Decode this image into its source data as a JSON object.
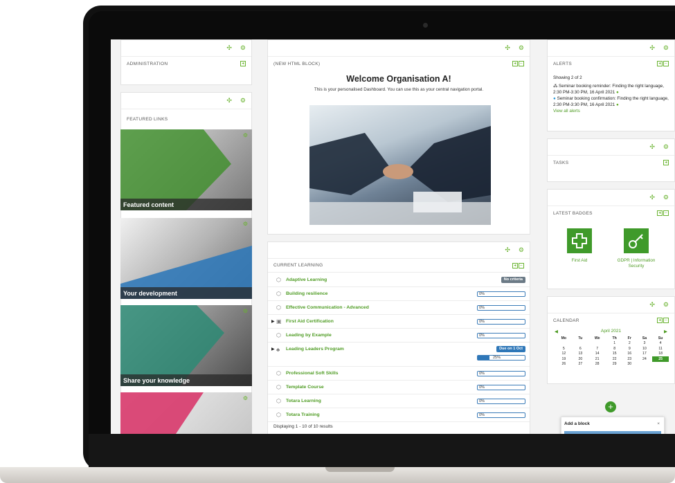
{
  "left": {
    "administration_title": "ADMINISTRATION",
    "featured_title": "FEATURED LINKS",
    "tiles": [
      {
        "label": "Featured content",
        "color": "#3f8f2c"
      },
      {
        "label": "Your development",
        "color": "#2e77b8"
      },
      {
        "label": "Share your knowledge",
        "color": "#2a8a74"
      },
      {
        "label": "",
        "color": "#d8396b"
      }
    ]
  },
  "middle": {
    "html_block_title": "(NEW HTML BLOCK)",
    "welcome_title": "Welcome Organisation A!",
    "welcome_text": "This is your personalised Dashboard.  You can use this as your central navigation portal.",
    "current_learning_title": "CURRENT LEARNING",
    "items": [
      {
        "name": "Adaptive Learning",
        "status": "No criteria"
      },
      {
        "name": "Building resilience",
        "progress": "0%"
      },
      {
        "name": "Effective Communication - Advanced",
        "progress": "0%"
      },
      {
        "name": "First Aid Certification",
        "progress": "0%"
      },
      {
        "name": "Leading by Example",
        "progress": "0%"
      },
      {
        "name": "Leading Leaders Program",
        "due": "Due on 1 Oct",
        "progress": "25%",
        "progress_value": 0.25
      },
      {
        "name": "Professional Soft Skills",
        "progress": "0%"
      },
      {
        "name": "Template Course",
        "progress": "0%"
      },
      {
        "name": "Totara Learning",
        "progress": "0%"
      },
      {
        "name": "Totara Training",
        "progress": "0%"
      }
    ],
    "footer": "Displaying 1 - 10 of 10 results"
  },
  "right": {
    "alerts_title": "ALERTS",
    "alerts_showing": "Showing 2 of 2",
    "alert_1": "Seminar booking reminder: Finding the right language, 2:30 PM-3:30 PM, 16 April 2021",
    "alert_2": "Seminar booking confirmation: Finding the right language, 2:30 PM-3:30 PM, 16 April 2021",
    "view_all": "View all alerts",
    "tasks_title": "TASKS",
    "badges_title": "LATEST BADGES",
    "badge_1": "First Aid",
    "badge_2": "GDPR | Information Security",
    "calendar_title": "CALENDAR",
    "calendar_month": "April 2021",
    "calendar_days": [
      "Mo",
      "Tu",
      "We",
      "Th",
      "Fr",
      "Sa",
      "Su"
    ],
    "calendar_weeks": [
      [
        "",
        "",
        "",
        "1",
        "2",
        "3",
        "4"
      ],
      [
        "5",
        "6",
        "7",
        "8",
        "9",
        "10",
        "11"
      ],
      [
        "12",
        "13",
        "14",
        "15",
        "16",
        "17",
        "18"
      ],
      [
        "19",
        "20",
        "21",
        "22",
        "23",
        "24",
        "25"
      ],
      [
        "26",
        "27",
        "28",
        "29",
        "30",
        "",
        ""
      ]
    ],
    "calendar_today": "25",
    "add_block_title": "Add a block"
  },
  "colors": {
    "accent": "#69b32f",
    "link": "#4f9c24",
    "progress": "#2e77b8"
  }
}
